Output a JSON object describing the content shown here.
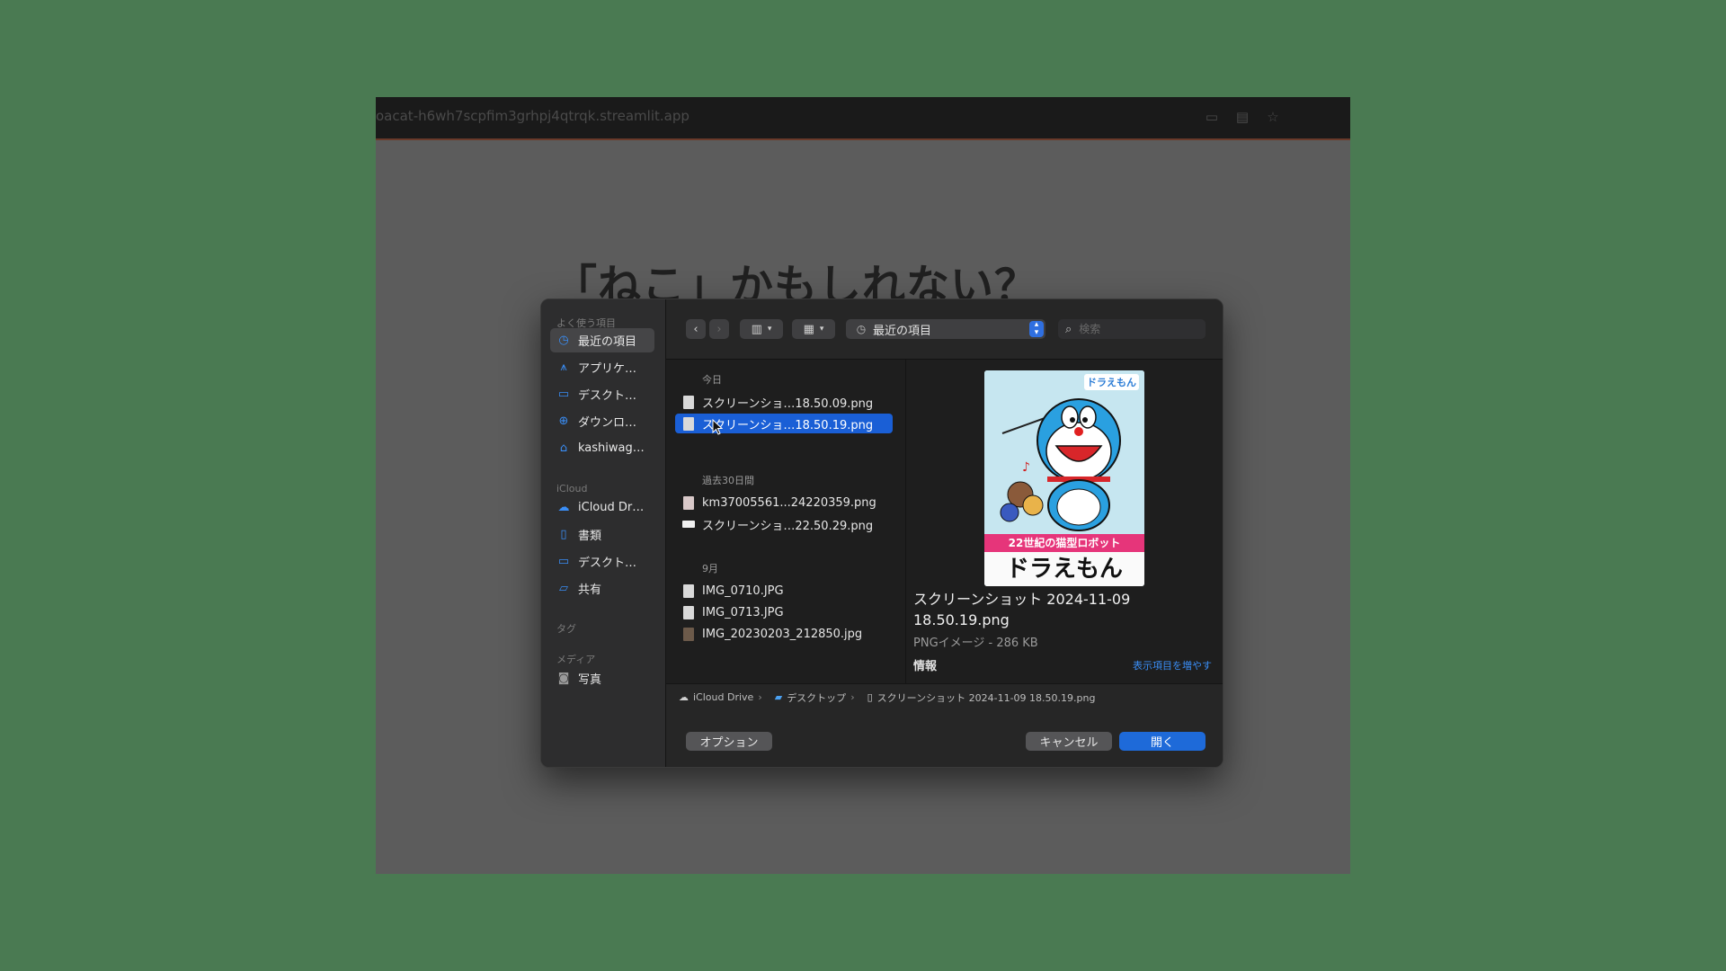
{
  "browser": {
    "url": "oacat-h6wh7scpfim3grhpj4qtrqk.streamlit.app",
    "page_heading": "「ねこ」かもしれない？"
  },
  "sidebar": {
    "favorites_label": "よく使う項目",
    "favorites": [
      {
        "label": "最近の項目",
        "icon": "clock-icon"
      },
      {
        "label": "アプリケーション",
        "icon": "applications-icon"
      },
      {
        "label": "デスクトップ",
        "icon": "desktop-icon"
      },
      {
        "label": "ダウンロード",
        "icon": "download-icon"
      },
      {
        "label": "kashiwagi...",
        "icon": "home-icon"
      }
    ],
    "icloud_label": "iCloud",
    "icloud": [
      {
        "label": "iCloud Drive",
        "icon": "cloud-icon"
      },
      {
        "label": "書類",
        "icon": "document-icon"
      },
      {
        "label": "デスクトップ",
        "icon": "desktop-icon"
      },
      {
        "label": "共有",
        "icon": "shared-folder-icon"
      }
    ],
    "tags_label": "タグ",
    "media_label": "メディア",
    "media": [
      {
        "label": "写真",
        "icon": "camera-icon"
      }
    ]
  },
  "toolbar": {
    "back": "‹",
    "forward": "›",
    "location": "最近の項目",
    "search_placeholder": "検索"
  },
  "files": {
    "sections": [
      {
        "label": "今日",
        "items": [
          {
            "name": "スクリーンショ…18.50.09.png",
            "selected": false
          },
          {
            "name": "スクリーンショ…18.50.19.png",
            "selected": true
          }
        ]
      },
      {
        "label": "過去30日間",
        "items": [
          {
            "name": "km37005561...24220359.png",
            "selected": false
          },
          {
            "name": "スクリーンショ…22.50.29.png",
            "selected": false
          }
        ]
      },
      {
        "label": "9月",
        "items": [
          {
            "name": "IMG_0710.JPG",
            "selected": false
          },
          {
            "name": "IMG_0713.JPG",
            "selected": false
          },
          {
            "name": "IMG_20230203_212850.jpg",
            "selected": false
          }
        ]
      }
    ]
  },
  "preview": {
    "poster_logo": "ドラえもん",
    "poster_band": "22世紀の猫型ロボット",
    "poster_title": "ドラえもん",
    "name_line1": "スクリーンショット 2024-11-09",
    "name_line2": "18.50.19.png",
    "kind": "PNGイメージ - 286 KB",
    "info_label": "情報",
    "show_more": "表示項目を増やす"
  },
  "pathbar": {
    "segments": [
      "iCloud Drive",
      "デスクトップ",
      "スクリーンショット 2024-11-09 18.50.19.png"
    ]
  },
  "footer": {
    "options": "オプション",
    "cancel": "キャンセル",
    "open": "開く"
  }
}
